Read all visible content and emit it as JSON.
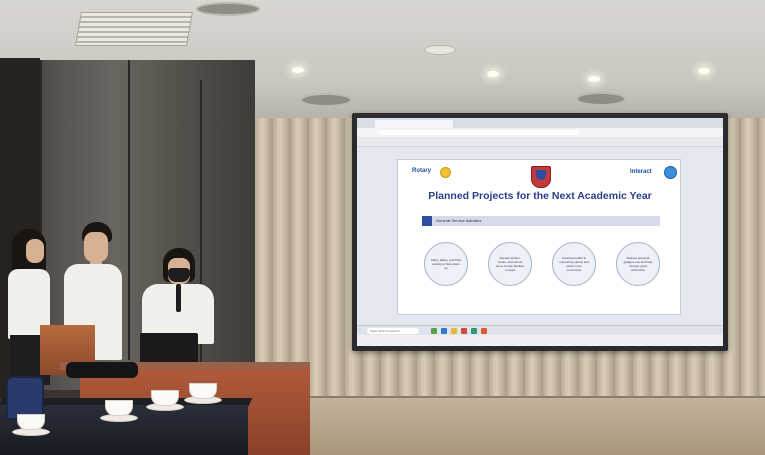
{
  "screen": {
    "slide_title": "Planned Projects for the Next Academic Year",
    "logo_left": "Rotary",
    "logo_right": "Interact",
    "section_heading": "General Service Activities",
    "circles": [
      "Marry, Eklep, and Pilot activity to help clean up",
      "Donate clothes, books, and school items to help families in need",
      "Continued effort in supporting elderly and youth in the community",
      "Reduce personal gadgets use and help through good citizenship"
    ],
    "taskbar_search": "Type here to search"
  },
  "colors": {
    "slide_title": "#2c3e8c",
    "tablecloth": "#b05a3b",
    "curtain": "#d8cdb9"
  }
}
